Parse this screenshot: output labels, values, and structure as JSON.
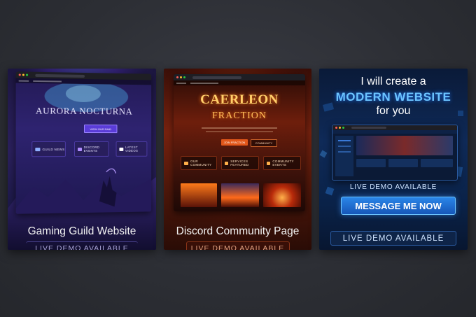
{
  "cards": [
    {
      "hero_title": "AURORA NOCTURNA",
      "cta_label": "VIEW OUR RAID",
      "features": [
        "GUILD NEWS",
        "DISCORD EVENTS",
        "LATEST VIDEOS"
      ],
      "title": "Gaming Guild Website",
      "badge": "LIVE DEMO AVAILABLE"
    },
    {
      "hero_title_1": "CAERLEON",
      "hero_title_2": "FRACTION",
      "btn_primary": "JOIN FRACTION",
      "btn_secondary": "COMMUNITY",
      "features": [
        "OUR COMMUNITY",
        "SERVICES FEATURED",
        "COMMUNITY EVENTS"
      ],
      "title": "Discord Community Page",
      "badge": "LIVE DEMO AVAILABLE"
    },
    {
      "headline_1": "I will create a",
      "headline_2": "MODERN WEBSITE",
      "headline_3": "for you",
      "demo_label": "LIVE DEMO AVAILABLE",
      "cta_label": "MESSAGE ME NOW",
      "badge": "LIVE DEMO AVAILABLE"
    }
  ],
  "colors": {
    "purple_accent": "#7b5cff",
    "ember_accent": "#ff7a2a",
    "blue_accent": "#3aa0ff"
  }
}
